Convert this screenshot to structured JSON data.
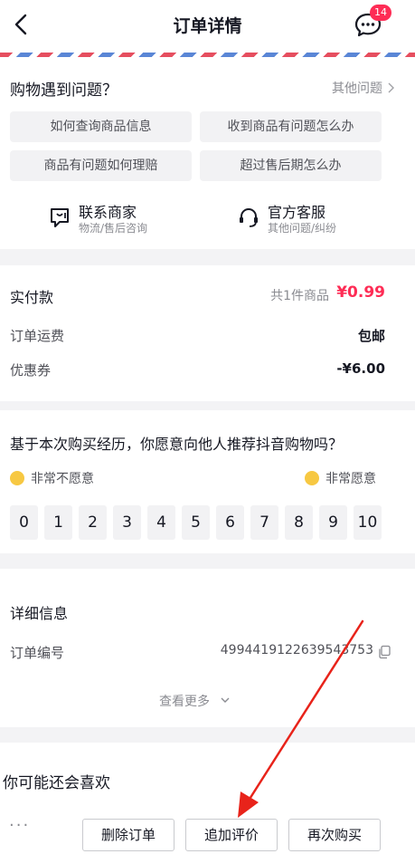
{
  "header": {
    "title": "订单详情",
    "message_badge": "14"
  },
  "problems": {
    "title": "购物遇到问题？",
    "other": "其他问题",
    "quick_questions": [
      "如何查询商品信息",
      "收到商品有问题怎么办",
      "商品有问题如何理赔",
      "超过售后期怎么办"
    ],
    "services": [
      {
        "title": "联系商家",
        "subtitle": "物流/售后咨询",
        "icon": "store-chat-icon"
      },
      {
        "title": "官方客服",
        "subtitle": "其他问题/纠纷",
        "icon": "headset-icon"
      }
    ]
  },
  "payment": {
    "label": "实付款",
    "count": "共1件商品",
    "price": "¥0.99",
    "rows": [
      {
        "label": "订单运费",
        "value": "包邮"
      },
      {
        "label": "优惠券",
        "value": "-¥6.00"
      }
    ]
  },
  "survey": {
    "question": "基于本次购买经历，你愿意向他人推荐抖音购物吗？",
    "low_label": "非常不愿意",
    "high_label": "非常愿意",
    "scores": [
      "0",
      "1",
      "2",
      "3",
      "4",
      "5",
      "6",
      "7",
      "8",
      "9",
      "10"
    ]
  },
  "details": {
    "title": "详细信息",
    "order_label": "订单编号",
    "order_number": "4994419122639543753",
    "more": "查看更多"
  },
  "recommend": {
    "title": "你可能还会喜欢"
  },
  "bottom_bar": {
    "more": "···",
    "delete": "删除订单",
    "review": "追加评价",
    "rebuy": "再次购买"
  },
  "colors": {
    "accent": "#fe2c55",
    "annotation_arrow": "#e8231a"
  }
}
